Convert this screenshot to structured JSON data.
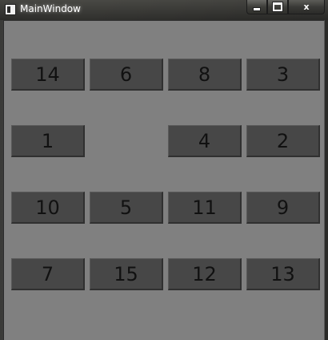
{
  "window": {
    "title": "MainWindow",
    "caption_buttons": {
      "minimize_icon": "minimize-icon",
      "maximize_icon": "maximize-icon",
      "close_icon": "close-icon",
      "close_glyph": "x"
    }
  },
  "puzzle": {
    "tiles": [
      "14",
      "6",
      "8",
      "3",
      "1",
      "4",
      "2",
      "10",
      "5",
      "11",
      "9",
      "7",
      "15",
      "12",
      "13"
    ]
  },
  "colors": {
    "client_background": "#808080",
    "tile_background": "#474747",
    "tile_text": "#111111"
  }
}
